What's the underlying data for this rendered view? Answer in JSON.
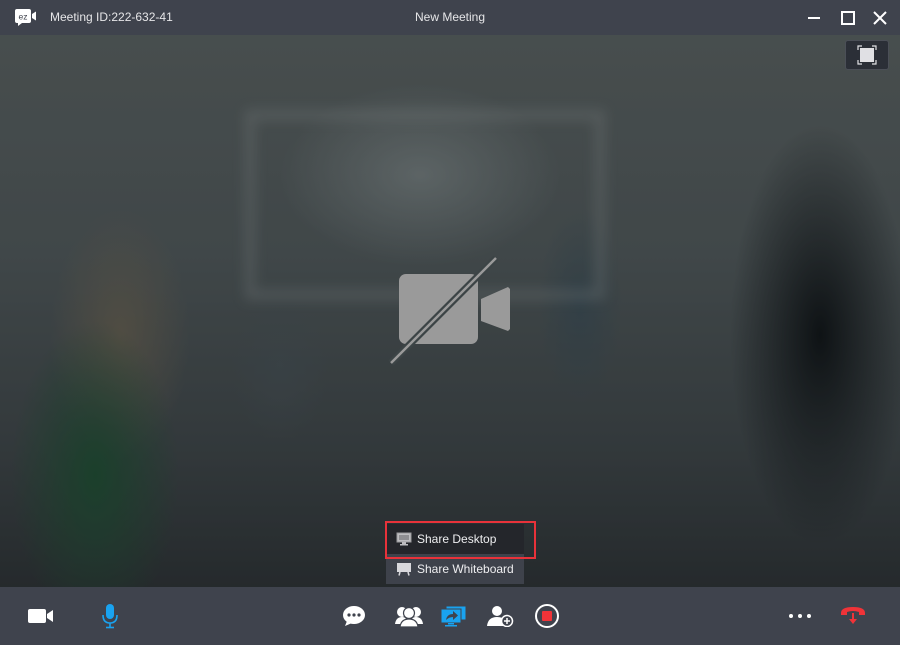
{
  "titlebar": {
    "logo_text": "ez",
    "meeting_id": "Meeting ID:222-632-41",
    "window_title": "New Meeting",
    "buttons": [
      "minimize",
      "maximize",
      "close"
    ]
  },
  "stage": {
    "camera_state": "off",
    "fullscreen_button": "fullscreen"
  },
  "share_menu": {
    "items": [
      {
        "label": "Share Desktop",
        "icon": "monitor-icon",
        "highlighted": true
      },
      {
        "label": "Share Whiteboard",
        "icon": "whiteboard-icon",
        "highlighted": false
      }
    ]
  },
  "toolbar": {
    "left": [
      {
        "name": "camera",
        "state": "off"
      },
      {
        "name": "microphone",
        "state": "on"
      }
    ],
    "center": [
      {
        "name": "chat"
      },
      {
        "name": "participants"
      },
      {
        "name": "share-screen",
        "active": true
      },
      {
        "name": "invite"
      },
      {
        "name": "record"
      }
    ],
    "right": [
      {
        "name": "more"
      },
      {
        "name": "leave-meeting"
      }
    ]
  },
  "colors": {
    "accent_blue": "#19a3f0",
    "danger_red": "#f03338",
    "bar_bg": "#3f434d",
    "highlight_border": "#e8323a"
  }
}
